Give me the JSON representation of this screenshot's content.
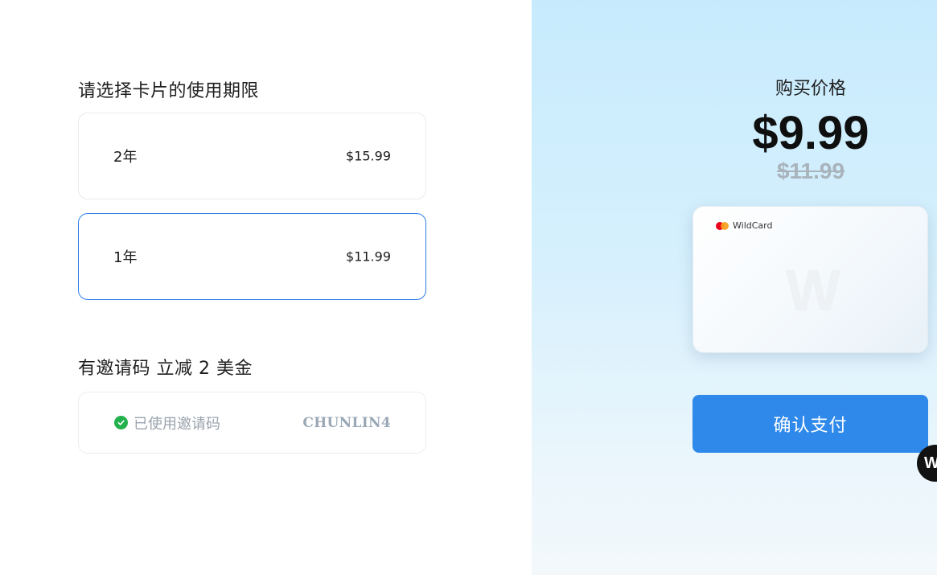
{
  "duration_section": {
    "title": "请选择卡片的使用期限",
    "plans": [
      {
        "duration": "2年",
        "price": "$15.99",
        "selected": false
      },
      {
        "duration": "1年",
        "price": "$11.99",
        "selected": true
      }
    ]
  },
  "invite_section": {
    "title": "有邀请码 立减 2 美金",
    "status": "已使用邀请码",
    "status_icon": "check-circle-icon",
    "code": "CHUNLIN4"
  },
  "purchase": {
    "label": "购买价格",
    "current_price": "$9.99",
    "original_price": "$11.99"
  },
  "card": {
    "brand": "WildCard",
    "watermark": "W"
  },
  "confirm_button_label": "确认支付",
  "floating_badge_text": "W",
  "colors": {
    "accent": "#2f89ea",
    "selected_border": "#2d7fe6",
    "success": "#22b14c",
    "muted_text": "#9aa3ad"
  }
}
